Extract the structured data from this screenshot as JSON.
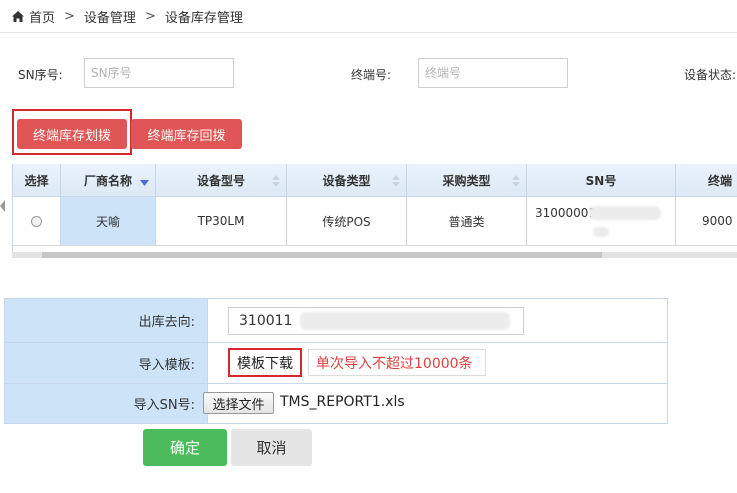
{
  "breadcrumb": {
    "home": "首页",
    "level2": "设备管理",
    "level3": "设备库存管理",
    "separator": ">"
  },
  "filters": {
    "sn_label": "SN序号:",
    "sn_placeholder": "SN序号",
    "terminal_label": "终端号:",
    "terminal_placeholder": "终端号",
    "status_label": "设备状态:"
  },
  "actions": {
    "allocate": "终端库存划拨",
    "recall": "终端库存回拨"
  },
  "table": {
    "columns": [
      "选择",
      "厂商名称",
      "设备型号",
      "设备类型",
      "采购类型",
      "SN号",
      "终端"
    ],
    "rows": [
      {
        "vendor": "天喻",
        "model": "TP30LM",
        "device_type": "传统POS",
        "purchase_type": "普通类",
        "sn": "31000001",
        "terminal": "9000"
      }
    ]
  },
  "form": {
    "destination_label": "出库去向:",
    "destination_value": "310011",
    "template_label": "导入模板:",
    "template_download": "模板下载",
    "template_hint": "单次导入不超过10000条",
    "sn_import_label": "导入SN号:",
    "choose_file": "选择文件",
    "file_name": "TMS_REPORT1.xls"
  },
  "buttons": {
    "confirm": "确定",
    "cancel": "取消"
  },
  "colors": {
    "accent_red": "#e05555",
    "highlight_red": "#d7262c",
    "label_blue": "#cde3f8",
    "confirm_green": "#4cbb5c"
  }
}
